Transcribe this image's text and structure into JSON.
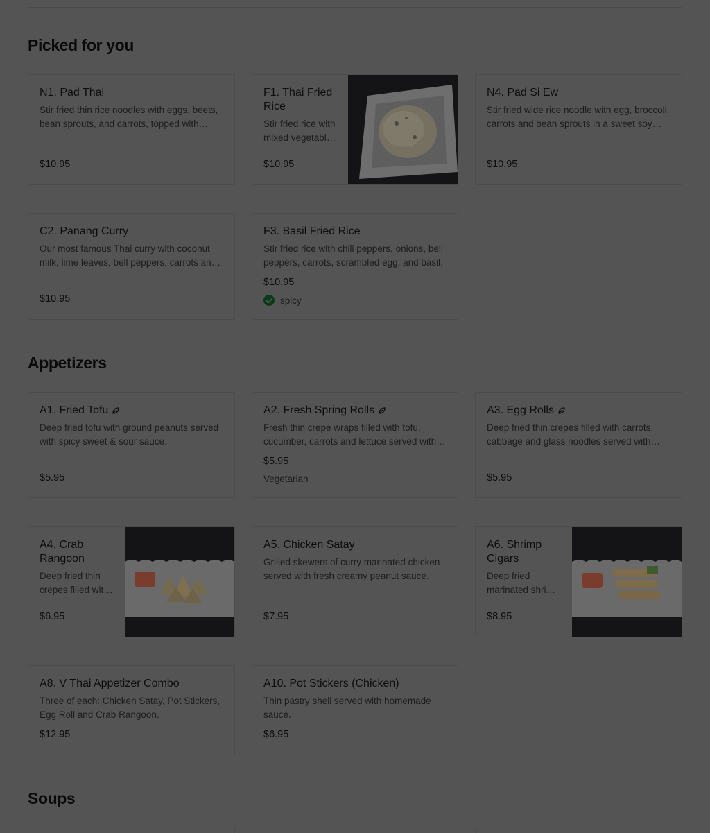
{
  "sections": {
    "picked": "Picked for you",
    "appetizers": "Appetizers",
    "soups": "Soups"
  },
  "items": {
    "n1": {
      "name": "N1. Pad Thai",
      "desc": "Stir fried thin rice noodles with eggs, beets, bean sprouts, and carrots, topped with ground peanuts.",
      "price": "$10.95"
    },
    "f1": {
      "name": "F1. Thai Fried Rice",
      "desc": "Stir fried rice with mixed vegetables and egg.",
      "price": "$10.95"
    },
    "n4": {
      "name": "N4. Pad Si Ew",
      "desc": "Stir fried wide rice noodle with egg, broccoli, carrots and bean sprouts in a sweet soy sauce.",
      "price": "$10.95"
    },
    "c2": {
      "name": "C2. Panang Curry",
      "desc": "Our most famous Thai curry with coconut milk, lime leaves, bell peppers, carrots and basil.",
      "price": "$10.95"
    },
    "f3": {
      "name": "F3. Basil Fried Rice",
      "desc": "Stir fried rice with chili peppers, onions, bell peppers, carrots, scrambled egg, and basil.",
      "price": "$10.95",
      "tag": "spicy"
    },
    "a1": {
      "name": "A1. Fried Tofu",
      "desc": "Deep fried tofu with ground peanuts served with spicy sweet & sour sauce.",
      "price": "$5.95"
    },
    "a2": {
      "name": "A2. Fresh Spring Rolls",
      "desc": "Fresh thin crepe wraps filled with tofu, cucumber, carrots and lettuce served with sauce.",
      "price": "$5.95",
      "tag": "Vegetarian"
    },
    "a3": {
      "name": "A3. Egg Rolls",
      "desc": "Deep fried thin crepes filled with carrots, cabbage and glass noodles served with sauce.",
      "price": "$5.95"
    },
    "a4": {
      "name": "A4. Crab Rangoon",
      "desc": "Deep fried thin crepes filled with cream cheese and crab.",
      "price": "$6.95"
    },
    "a5": {
      "name": "A5. Chicken Satay",
      "desc": "Grilled skewers of curry marinated chicken served with fresh creamy peanut sauce.",
      "price": "$7.95"
    },
    "a6": {
      "name": "A6. Shrimp Cigars",
      "desc": "Deep fried marinated shrimp wrapped in thin crepes.",
      "price": "$8.95"
    },
    "a8": {
      "name": "A8. V Thai Appetizer Combo",
      "desc": "Three of each: Chicken Satay, Pot Stickers, Egg Roll and Crab Rangoon.",
      "price": "$12.95"
    },
    "a10": {
      "name": "A10. Pot Stickers (Chicken)",
      "desc": "Thin pastry shell served with homemade sauce.",
      "price": "$6.95"
    }
  },
  "icons": {
    "leaf": "leaf-icon",
    "check": "check-circle-icon"
  },
  "colors": {
    "overlay_background": "#545454",
    "check_green": "#0b3a18"
  }
}
